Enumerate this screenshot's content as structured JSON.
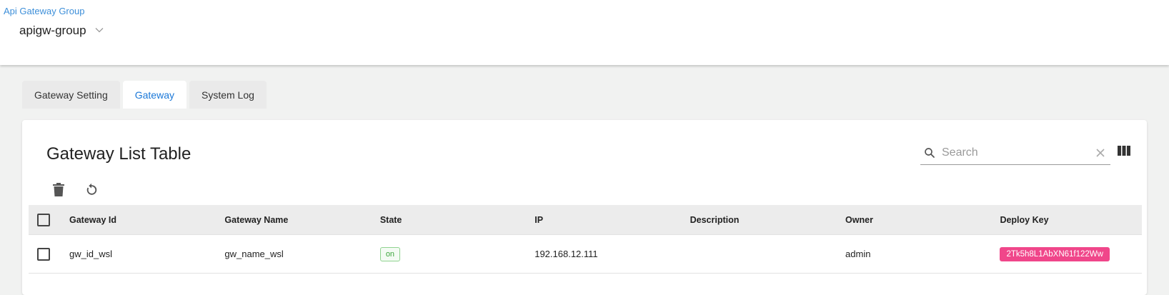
{
  "header": {
    "breadcrumb": "Api Gateway Group",
    "group_value": "apigw-group"
  },
  "tabs": [
    {
      "label": "Gateway Setting"
    },
    {
      "label": "Gateway"
    },
    {
      "label": "System Log"
    }
  ],
  "active_tab": "Gateway",
  "card": {
    "title": "Gateway List Table",
    "search_placeholder": "Search"
  },
  "table": {
    "columns": [
      "Gateway Id",
      "Gateway Name",
      "State",
      "IP",
      "Description",
      "Owner",
      "Deploy Key"
    ],
    "rows": [
      {
        "gateway_id": "gw_id_wsl",
        "gateway_name": "gw_name_wsl",
        "state": "on",
        "ip": "192.168.12.111",
        "description": "",
        "owner": "admin",
        "deploy_key": "2Tk5h8L1AbXN61f122Ww"
      }
    ]
  },
  "colors": {
    "link": "#3d8fd9",
    "active_tab": "#1b78d8",
    "state_on": "#3fa63f",
    "deploy_key_bg": "#f0468a"
  },
  "icons": {
    "group_select": "chevron-down-icon",
    "search": "search-icon",
    "clear": "close-icon",
    "columns": "view-column-icon",
    "delete": "trash-icon",
    "refresh": "refresh-icon"
  }
}
